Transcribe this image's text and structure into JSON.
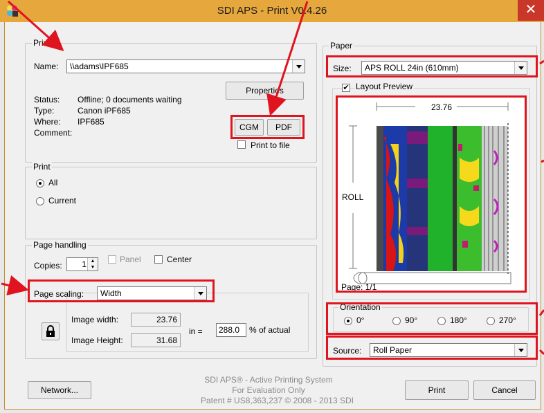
{
  "window": {
    "title": "SDI APS - Print V0.4.26",
    "close_glyph": "✕"
  },
  "printer": {
    "legend": "Printer",
    "name_label": "Name:",
    "name_value": "\\\\adams\\IPF685",
    "properties_label": "Properties",
    "status_label": "Status:",
    "status_value": "Offline; 0 documents waiting",
    "type_label": "Type:",
    "type_value": "Canon iPF685",
    "where_label": "Where:",
    "where_value": "IPF685",
    "comment_label": "Comment:",
    "cgm_label": "CGM",
    "pdf_label": "PDF",
    "print_to_file_label": "Print to file",
    "print_to_file_checked": false
  },
  "print": {
    "legend": "Print",
    "options": [
      {
        "label": "All",
        "checked": true
      },
      {
        "label": "Current",
        "checked": false
      }
    ]
  },
  "page_handling": {
    "legend": "Page handling",
    "copies_label": "Copies:",
    "copies_value": "1",
    "panel_label": "Panel",
    "center_label": "Center",
    "page_scaling_label": "Page scaling:",
    "page_scaling_value": "Width",
    "image_width_label": "Image width:",
    "image_width_value": "23.76",
    "image_height_label": "Image Height:",
    "image_height_value": "31.68",
    "in_label": "in =",
    "percent_value": "288.0",
    "percent_label": "% of actual",
    "lock_icon": "lock-icon"
  },
  "paper": {
    "legend": "Paper",
    "size_label": "Size:",
    "size_value": "APS ROLL 24in (610mm)",
    "layout_preview_label": "Layout Preview",
    "layout_preview_checked": true,
    "preview_width": "23.76",
    "preview_roll_label": "ROLL",
    "preview_page": "Page: 1/1"
  },
  "orientation": {
    "legend": "Orientation",
    "options": [
      {
        "label": "0°",
        "checked": true
      },
      {
        "label": "90°",
        "checked": false
      },
      {
        "label": "180°",
        "checked": false
      },
      {
        "label": "270°",
        "checked": false
      }
    ]
  },
  "source": {
    "label": "Source:",
    "value": "Roll Paper"
  },
  "footer": {
    "network_label": "Network...",
    "line1": "SDI APS® - Active Printing System",
    "line2": "For Evaluation Only",
    "line3": "Patent # US8,363,237 © 2008 - 2013 SDI",
    "print_label": "Print",
    "cancel_label": "Cancel"
  },
  "colors": {
    "title_bar": "#e6a73d",
    "annotation_red": "#e0141e",
    "close_button": "#c8372a"
  }
}
